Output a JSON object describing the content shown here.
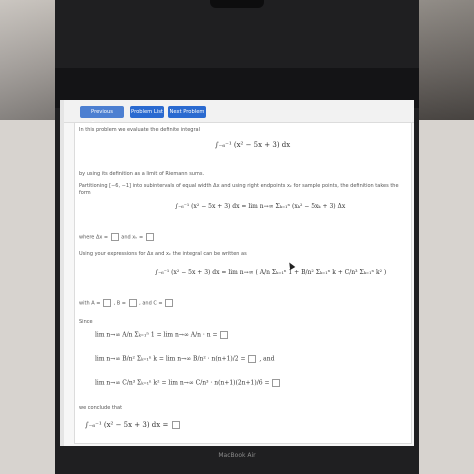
{
  "toolbar": {
    "prev_label": "Previous Problem",
    "list_label": "Problem List",
    "next_label": "Next Problem"
  },
  "problem": {
    "intro": "In this problem we evaluate the definite integral",
    "integral": "∫₋₆⁻¹ (x² − 5x + 3) dx",
    "method": "by using its definition as a limit of Riemann sums.",
    "partition": "Partitioning [−6, −1] into subintervals of equal width Δx and using right endpoints xₖ for sample points, the definition takes the form",
    "definition": "∫₋₆⁻¹ (x² − 5x + 3) dx = lim n→∞ Σₖ₌₁ⁿ (xₖ² − 5xₖ + 3) Δx",
    "where_prefix": "where Δx =",
    "and_xk": "and xₖ =",
    "using_expr": "Using your expressions for Δx and xₖ the integral can be written as",
    "rewritten": "∫₋₆⁻¹ (x² − 5x + 3) dx = lim n→∞ ( A/n Σₖ₌₁ⁿ 1 + B/n² Σₖ₌₁ⁿ k + C/n³ Σₖ₌₁ⁿ k² )",
    "with_a": "with A =",
    "b_label": ", B =",
    "c_label": ", and C =",
    "since": "Since",
    "lim1": "lim n→∞ A/n Σₖ₌₁ⁿ 1 = lim n→∞ A/n · n =",
    "lim2": "lim n→∞ B/n² Σₖ₌₁ⁿ k = lim n→∞ B/n² · n(n+1)/2 =",
    "lim2_suffix": ", and",
    "lim3": "lim n→∞ C/n³ Σₖ₌₁ⁿ k² = lim n→∞ C/n³ · n(n+1)(2n+1)/6 =",
    "conclude": "we conclude that",
    "final": "∫₋₆⁻¹ (x² − 5x + 3) dx ="
  },
  "bezel_label": "MacBook Air"
}
